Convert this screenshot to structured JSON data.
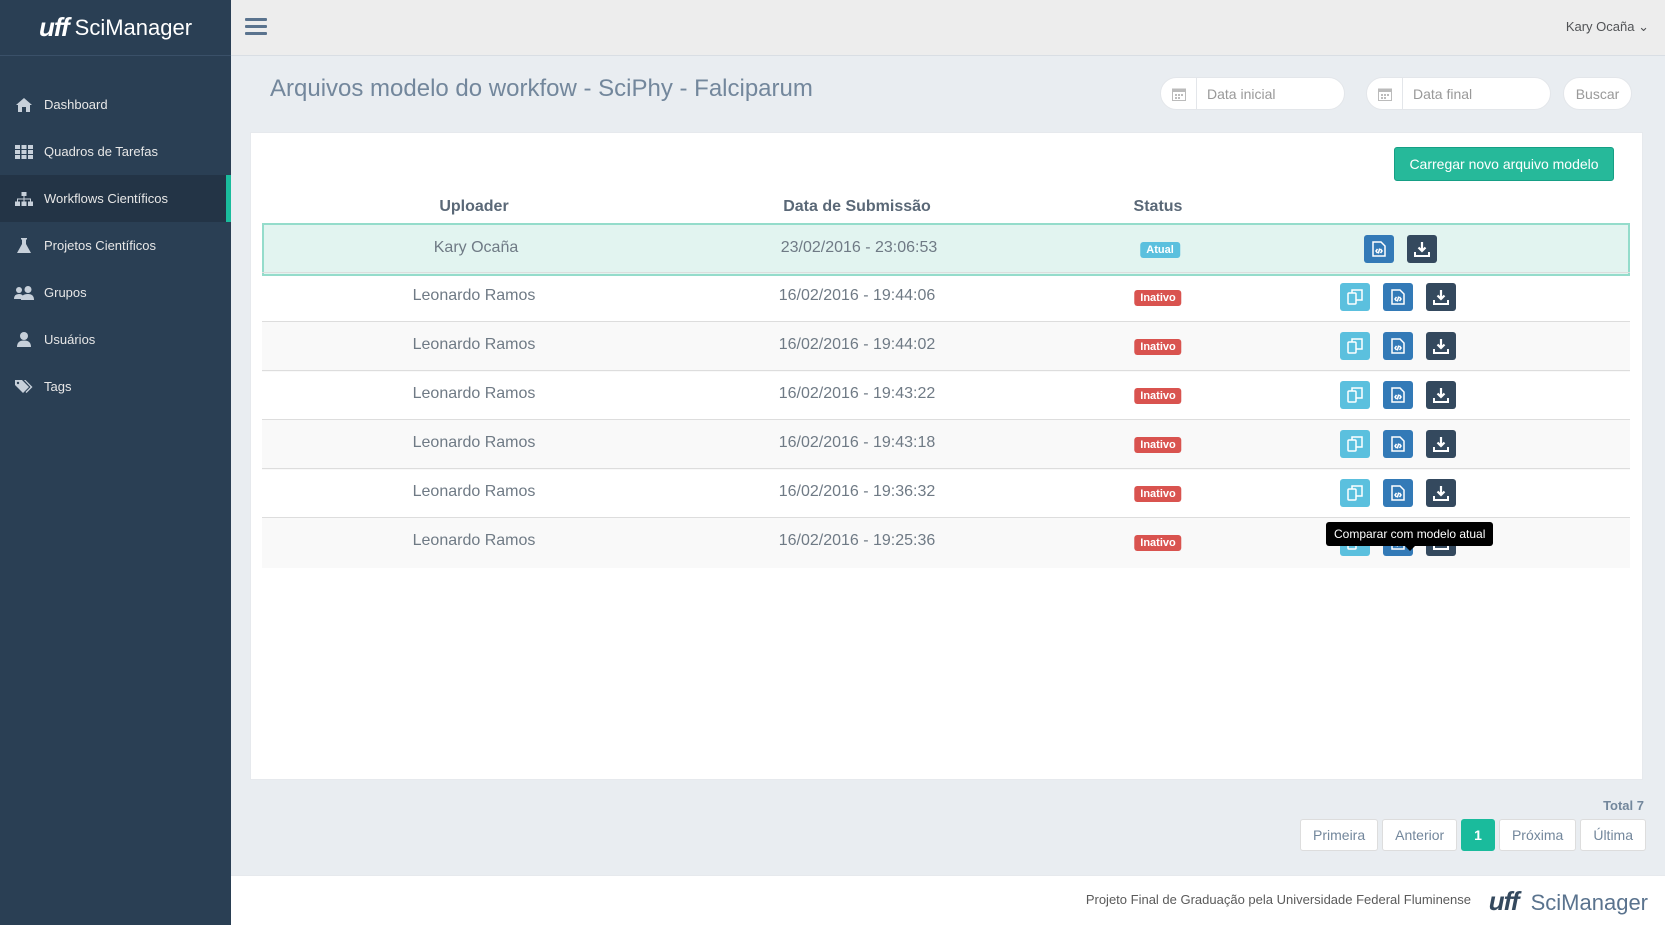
{
  "brand": {
    "logo": "uff",
    "name": "SciManager"
  },
  "sidebar": {
    "items": [
      {
        "label": "Dashboard",
        "icon": "home-icon"
      },
      {
        "label": "Quadros de Tarefas",
        "icon": "grid-icon"
      },
      {
        "label": "Workflows Científicos",
        "icon": "sitemap-icon",
        "active": true
      },
      {
        "label": "Projetos Científicos",
        "icon": "flask-icon"
      },
      {
        "label": "Grupos",
        "icon": "users-icon"
      },
      {
        "label": "Usuários",
        "icon": "user-icon"
      },
      {
        "label": "Tags",
        "icon": "tags-icon"
      }
    ]
  },
  "topbar": {
    "user": "Kary Ocaña"
  },
  "page": {
    "title": "Arquivos modelo do workfow - SciPhy - Falciparum",
    "filters": {
      "start_placeholder": "Data inicial",
      "end_placeholder": "Data final",
      "search_label": "Buscar"
    },
    "upload_label": "Carregar novo arquivo modelo"
  },
  "table": {
    "headers": [
      "Uploader",
      "Data de Submissão",
      "Status"
    ],
    "rows": [
      {
        "uploader": "Kary Ocaña",
        "date": "23/02/2016 - 23:06:53",
        "status": "Atual"
      },
      {
        "uploader": "Leonardo Ramos",
        "date": "16/02/2016 - 19:44:06",
        "status": "Inativo"
      },
      {
        "uploader": "Leonardo Ramos",
        "date": "16/02/2016 - 19:44:02",
        "status": "Inativo"
      },
      {
        "uploader": "Leonardo Ramos",
        "date": "16/02/2016 - 19:43:22",
        "status": "Inativo"
      },
      {
        "uploader": "Leonardo Ramos",
        "date": "16/02/2016 - 19:43:18",
        "status": "Inativo"
      },
      {
        "uploader": "Leonardo Ramos",
        "date": "16/02/2016 - 19:36:32",
        "status": "Inativo"
      },
      {
        "uploader": "Leonardo Ramos",
        "date": "16/02/2016 - 19:25:36",
        "status": "Inativo"
      }
    ]
  },
  "tooltip": "Comparar com modelo atual",
  "pagination": {
    "total": "Total 7",
    "first": "Primeira",
    "prev": "Anterior",
    "current": "1",
    "next": "Próxima",
    "last": "Última"
  },
  "footer": {
    "text": "Projeto Final de Graduação pela Universidade Federal Fluminense",
    "logo": "uff",
    "brand": "SciManager"
  },
  "colors": {
    "sidebar": "#2a3f54",
    "accent": "#1abb9c",
    "danger": "#d9534f",
    "info": "#5bc0de",
    "primary": "#337ab7",
    "dark": "#34495e"
  }
}
